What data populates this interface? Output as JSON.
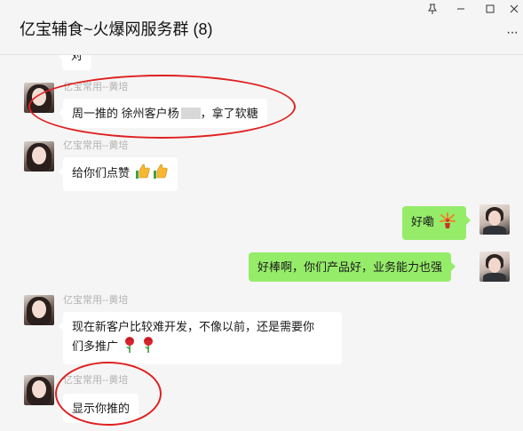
{
  "window": {
    "title": "亿宝辅食~火爆网服务群 (8)",
    "pin_icon": "pin-icon",
    "controls": [
      "minimize-icon",
      "maximize-icon",
      "close-icon"
    ],
    "more_icon": "more-icon"
  },
  "messages": [
    {
      "side": "left",
      "sender": "",
      "text": "对",
      "partial": true
    },
    {
      "side": "left",
      "sender": "亿宝常用--黄培",
      "text_before": "周一推的 徐州客户杨",
      "masked": true,
      "text_after": "，拿了软糖"
    },
    {
      "side": "left",
      "sender": "亿宝常用--黄培",
      "text": "给你们点赞",
      "emojis": [
        "thumbs-up-icon",
        "thumbs-up-icon"
      ]
    },
    {
      "side": "right",
      "text": "好嘞",
      "emojis": [
        "fireworks-icon"
      ]
    },
    {
      "side": "right",
      "text": "好棒啊，你们产品好，业务能力也强"
    },
    {
      "side": "left",
      "sender": "亿宝常用--黄培",
      "line1": "现在新客户比较难开发，不像以前，还是需要你",
      "line2": "们多推广",
      "emojis": [
        "rose-icon",
        "rose-icon"
      ]
    },
    {
      "side": "left",
      "sender": "亿宝常用--黄培",
      "text": "显示你推的"
    }
  ],
  "colors": {
    "background": "#f5f5f5",
    "bubble_self": "#95ec69",
    "bubble_other": "#ffffff",
    "annotation_red": "#e02020"
  }
}
